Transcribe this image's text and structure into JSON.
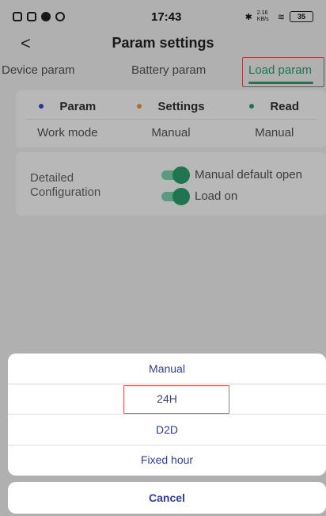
{
  "status_bar": {
    "time": "17:43",
    "network_speed": "2.16 KB/s",
    "battery": "35"
  },
  "header": {
    "back_icon": "<",
    "title": "Param settings"
  },
  "tabs": [
    {
      "label": "Device param",
      "active": false
    },
    {
      "label": "Battery param",
      "active": false
    },
    {
      "label": "Load param",
      "active": true
    }
  ],
  "param_table": {
    "headers": [
      {
        "label": "Param",
        "dot_color": "#2f4fc9"
      },
      {
        "label": "Settings",
        "dot_color": "#e6a13a"
      },
      {
        "label": "Read",
        "dot_color": "#2aa26e"
      }
    ],
    "row": {
      "param": "Work mode",
      "settings": "Manual",
      "read": "Manual"
    }
  },
  "configuration": {
    "label": "Detailed Configuration",
    "toggles": [
      {
        "label": "Manual default open",
        "on": true
      },
      {
        "label": "Load on",
        "on": true
      }
    ]
  },
  "action_sheet": {
    "options": [
      "Manual",
      "24H",
      "D2D",
      "Fixed hour"
    ],
    "highlighted_option": "24H",
    "cancel_label": "Cancel"
  },
  "colors": {
    "accent_green": "#2aa26e",
    "sheet_text": "#2f3d9c",
    "highlight_red": "#e05a56"
  }
}
